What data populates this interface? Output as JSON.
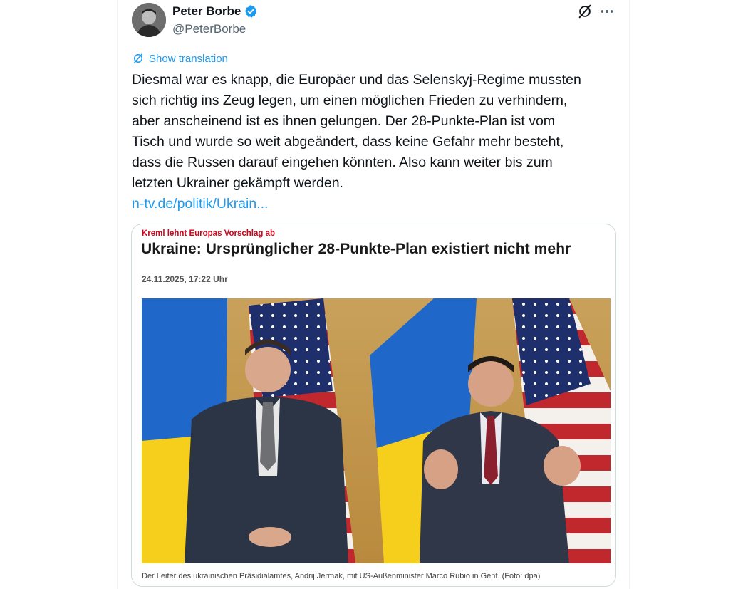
{
  "author": {
    "display_name": "Peter Borbe",
    "handle": "@PeterBorbe",
    "verified": true,
    "avatar_icon": "avatar-photo"
  },
  "actions": {
    "grok_icon": "grok-icon",
    "more_icon": "more-horizontal-icon"
  },
  "translation": {
    "label": "Show translation",
    "icon": "translate-icon"
  },
  "tweet": {
    "text_lines": [
      "Diesmal war es knapp, die Europäer und das Selenskyj-Regime mussten",
      "sich richtig ins Zeug legen, um einen möglichen Frieden zu verhindern,",
      "aber anscheinend ist es ihnen gelungen. Der 28-Punkte-Plan ist vom",
      "Tisch und wurde so weit abgeändert, dass keine Gefahr mehr besteht,",
      "dass die Russen darauf eingehen könnten. Also kann weiter bis zum",
      "letzten Ukrainer gekämpft werden."
    ],
    "link": "n-tv.de/politik/Ukrain..."
  },
  "card": {
    "kicker": "Kreml lehnt Europas Vorschlag ab",
    "headline": "Ukraine: Ursprünglicher 28-Punkte-Plan existiert nicht mehr",
    "date": "24.11.2025, 17:22 Uhr",
    "caption": "Der Leiter des ukrainischen Präsidialamtes, Andrij Jermak, mit US-Außenminister Marco Rubio in Genf. (Foto: dpa)"
  },
  "colors": {
    "link_blue": "#1d9bf0",
    "kicker_red": "#d0021b",
    "verified_blue": "#1d9bf0",
    "secondary_text": "#536471"
  }
}
